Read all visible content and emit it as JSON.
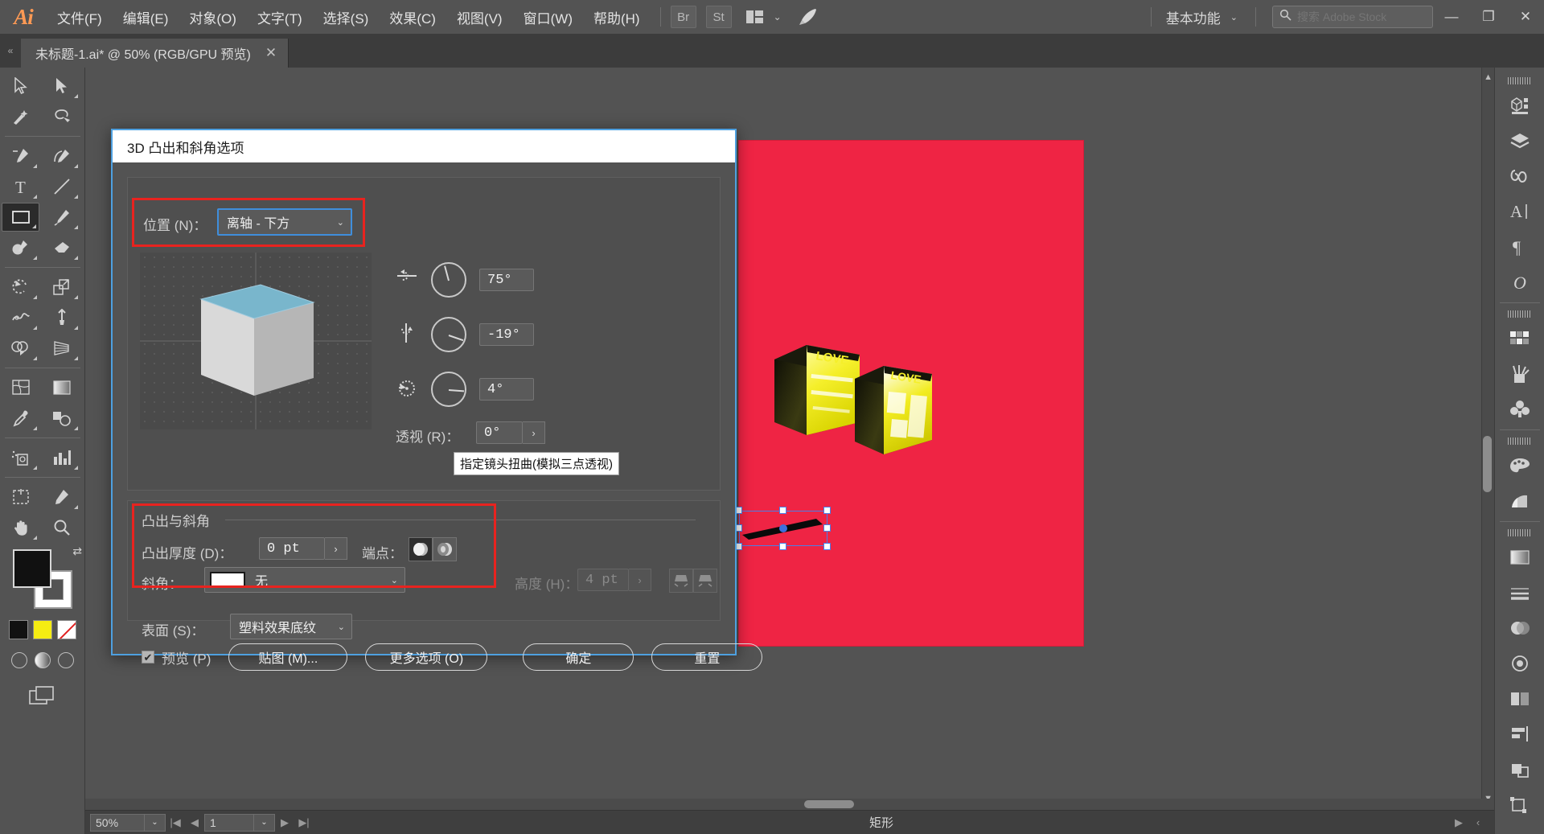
{
  "app": {
    "logo": "Ai",
    "menus": [
      "文件(F)",
      "编辑(E)",
      "对象(O)",
      "文字(T)",
      "选择(S)",
      "效果(C)",
      "视图(V)",
      "窗口(W)",
      "帮助(H)"
    ],
    "bridge_button": "Br",
    "stock_button": "St",
    "arrange_icon": "arrange-documents-icon",
    "rocket_icon": "discover-rocket-icon",
    "workspace": "基本功能",
    "workspace_chevron": "⌄",
    "search_placeholder": "搜索 Adobe Stock",
    "search_icon": "search-icon",
    "window_controls": {
      "minimize": "—",
      "maximize": "❐",
      "close": "✕"
    }
  },
  "tabbar": {
    "collapse_icon": "«",
    "document_title": "未标题-1.ai* @ 50% (RGB/GPU 预览)",
    "close_icon": "✕"
  },
  "toolbar": {
    "tools": [
      {
        "name": "selection-tool",
        "active": false
      },
      {
        "name": "direct-selection-tool",
        "active": false
      },
      {
        "name": "magic-wand-tool",
        "active": false
      },
      {
        "name": "lasso-tool",
        "active": false
      },
      {
        "name": "pen-tool",
        "active": false
      },
      {
        "name": "curvature-tool",
        "active": false
      },
      {
        "name": "type-tool",
        "active": false
      },
      {
        "name": "line-segment-tool",
        "active": false
      },
      {
        "name": "rectangle-tool",
        "active": true
      },
      {
        "name": "paintbrush-tool",
        "active": false
      },
      {
        "name": "shaper-tool",
        "active": false
      },
      {
        "name": "eraser-tool",
        "active": false
      },
      {
        "name": "rotate-tool",
        "active": false
      },
      {
        "name": "scale-tool",
        "active": false
      },
      {
        "name": "width-tool",
        "active": false
      },
      {
        "name": "free-transform-tool",
        "active": false
      },
      {
        "name": "shape-builder-tool",
        "active": false
      },
      {
        "name": "perspective-grid-tool",
        "active": false
      },
      {
        "name": "mesh-tool",
        "active": false
      },
      {
        "name": "gradient-tool",
        "active": false
      },
      {
        "name": "eyedropper-tool",
        "active": false
      },
      {
        "name": "blend-tool",
        "active": false
      },
      {
        "name": "symbol-sprayer-tool",
        "active": false
      },
      {
        "name": "column-graph-tool",
        "active": false
      },
      {
        "name": "artboard-tool",
        "active": false
      },
      {
        "name": "slice-tool",
        "active": false
      },
      {
        "name": "hand-tool",
        "active": false
      },
      {
        "name": "zoom-tool",
        "active": false
      }
    ],
    "fill_color": "#111111",
    "stroke_color": "#ffffff",
    "swatch_colors": [
      "#111111",
      "#f5ec12",
      "#ffffff"
    ]
  },
  "canvas": {
    "artboard_color": "#ef2444",
    "artwork_label": "3d-extruded-love-text",
    "selection_label": "selected-flat-black-shape"
  },
  "statusbar": {
    "zoom_value": "50%",
    "zoom_chevron": "⌄",
    "page_value": "1",
    "page_chevron": "⌄",
    "first_icon": "first-page-icon",
    "prev_icon": "prev-page-icon",
    "next_icon": "next-page-icon",
    "last_icon": "last-page-icon",
    "status_text": "矩形",
    "play_icon": "▶",
    "left_icon": "‹"
  },
  "rightpanel": {
    "groups": [
      {
        "icons": [
          "properties-icon",
          "layers-icon",
          "libraries-icon",
          "character-icon",
          "paragraph-icon",
          "glyphs-icon"
        ]
      },
      {
        "icons": [
          "swatches-icon",
          "brushes-icon",
          "symbols-icon"
        ]
      },
      {
        "icons": [
          "color-palette-icon",
          "color-guide-icon"
        ]
      },
      {
        "icons": [
          "gradient-icon",
          "stroke-icon",
          "transparency-icon",
          "appearance-icon",
          "graphic-styles-icon",
          "align-icon",
          "pathfinder-icon",
          "transform-icon"
        ]
      }
    ],
    "collapse_icon": "»"
  },
  "dialog": {
    "title": "3D 凸出和斜角选项",
    "position": {
      "label": "位置 (N)：",
      "value": "离轴 - 下方",
      "chevron": "⌄"
    },
    "rotations": [
      {
        "icon": "rotate-x-axis-icon",
        "value": "75°",
        "angle": 75
      },
      {
        "icon": "rotate-y-axis-icon",
        "value": "-19°",
        "angle": -19
      },
      {
        "icon": "rotate-z-axis-icon",
        "value": "4°",
        "angle": 4
      }
    ],
    "perspective": {
      "label": "透视 (R)：",
      "value": "0°",
      "stepper": "›",
      "tooltip": "指定镜头扭曲(模拟三点透视)"
    },
    "extrude_group": {
      "title": "凸出与斜角",
      "depth_label": "凸出厚度 (D)：",
      "depth_value": "0 pt",
      "depth_stepper": "›",
      "cap_label": "端点：",
      "cap_solid_icon": "cap-solid-icon",
      "cap_hollow_icon": "cap-hollow-icon",
      "bevel_label": "斜角：",
      "bevel_value": "无",
      "bevel_chevron": "⌄",
      "height_label": "高度 (H)：",
      "height_value": "4 pt",
      "height_stepper": "›",
      "bevel_out_icon": "bevel-extent-out-icon",
      "bevel_in_icon": "bevel-extent-in-icon"
    },
    "surface": {
      "label": "表面 (S)：",
      "value": "塑料效果底纹",
      "chevron": "⌄"
    },
    "footer": {
      "preview_label": "预览 (P)",
      "preview_checked": true,
      "checkmark": "✔",
      "map_art_button": "贴图 (M)...",
      "more_options_button": "更多选项 (O)",
      "ok_button": "确定",
      "reset_button": "重置"
    }
  }
}
